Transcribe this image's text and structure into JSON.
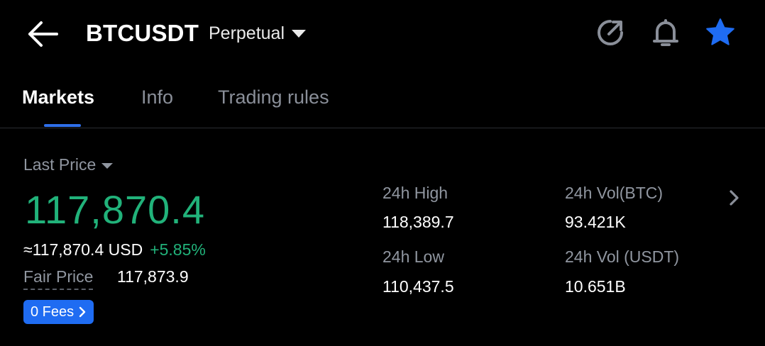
{
  "header": {
    "symbol": "BTCUSDT",
    "contract_type": "Perpetual",
    "icons": [
      "back-arrow-icon",
      "share-icon",
      "bell-icon",
      "star-icon"
    ],
    "accent_color": "#1f6cf2"
  },
  "tabs": [
    {
      "label": "Markets",
      "active": true
    },
    {
      "label": "Info",
      "active": false
    },
    {
      "label": "Trading rules",
      "active": false
    }
  ],
  "price": {
    "label": "Last Price",
    "value": "117,870.4",
    "approx_usd": "≈117,870.4 USD",
    "change": "+5.85%",
    "color": "#21b27a",
    "fair_label": "Fair Price",
    "fair_value": "117,873.9",
    "fees_label": "0 Fees"
  },
  "stats": {
    "high_label": "24h High",
    "high_value": "118,389.7",
    "low_label": "24h Low",
    "low_value": "110,437.5",
    "vol_btc_label": "24h Vol(BTC)",
    "vol_btc_value": "93.421K",
    "vol_usdt_label": "24h Vol (USDT)",
    "vol_usdt_value": "10.651B"
  }
}
